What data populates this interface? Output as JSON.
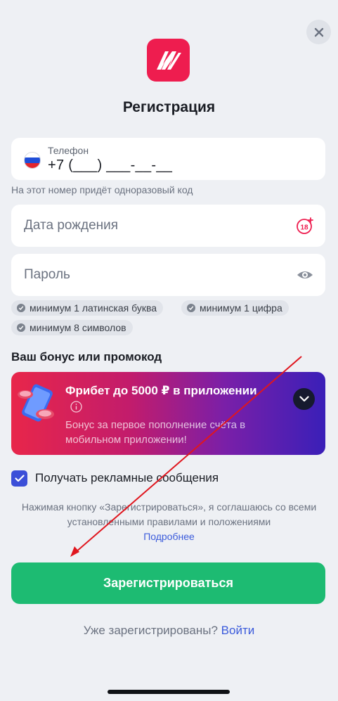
{
  "header": {
    "title": "Регистрация"
  },
  "phone": {
    "label": "Телефон",
    "value": "+7 (___) ___-__-__",
    "hint": "На этот номер придёт одноразовый код"
  },
  "birthdate": {
    "placeholder": "Дата рождения",
    "age_badge": "18+"
  },
  "password": {
    "placeholder": "Пароль"
  },
  "password_rules": [
    "минимум 1 латинская буква",
    "минимум 1 цифра",
    "минимум 8 символов"
  ],
  "bonus": {
    "section_title": "Ваш бонус или промокод",
    "title": "Фрибет до 5000 ₽ в приложении",
    "description": "Бонус за первое пополнение счёта в мобильном приложении!"
  },
  "ads_consent": {
    "label": "Получать рекламные сообщения",
    "checked": true
  },
  "terms": {
    "text": "Нажимая кнопку «Зарегистрироваться», я соглашаюсь со всеми установленными правилами и положениями",
    "link": "Подробнее"
  },
  "submit": {
    "label": "Зарегистрироваться"
  },
  "login": {
    "question": "Уже зарегистрированы?",
    "link": "Войти"
  },
  "colors": {
    "accent": "#1dbb72",
    "brand": "#ee1d4f",
    "link": "#3b5bdb",
    "annotation": "#e0161e"
  }
}
